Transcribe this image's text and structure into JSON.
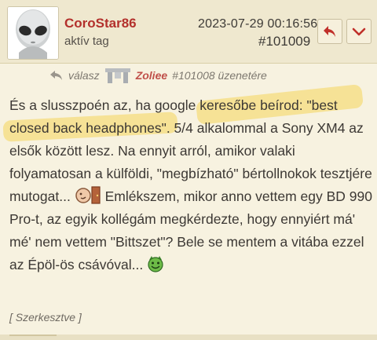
{
  "post": {
    "username": "CoroStar86",
    "user_tag": "aktív tag",
    "timestamp": "2023-07-29 00:16:56",
    "post_id": "#101009",
    "reply": {
      "prefix": "válasz",
      "to_user": "Zoliee",
      "to_post": "#101008 üzenetére"
    },
    "body": {
      "part1": "És a slusszpoén az, ha google keresőbe beírod: \"best closed back headphones\". 5/4 alkalommal a Sony XM4 az elsők között lesz. Na ennyit arról, amikor valaki folyamatosan a külföldi, \"megbízható\" bértollnokok tesztjére mutogat...",
      "part2": "Emlékszem, mikor anno vettem egy BD 990 Pro-t, az egyik kollégám megkérdezte, hogy ennyiért má' mé' nem vettem \"Bittszet\"? Bele se mentem a vitába ezzel az Épöl-ös csávóval..."
    },
    "edited": "[ Szerkesztve ]"
  },
  "icons": {
    "reply_button": "reply-arrow-icon",
    "more_button": "chevron-down-icon",
    "reply_indicator": "reply-arrow-icon",
    "emoticon_1": "face-with-door-emoticon",
    "emoticon_2": "green-devil-emoticon"
  },
  "colors": {
    "background": "#f7f2e0",
    "header": "#efe8cf",
    "username": "#b3302c",
    "highlight": "#f6d65a"
  }
}
